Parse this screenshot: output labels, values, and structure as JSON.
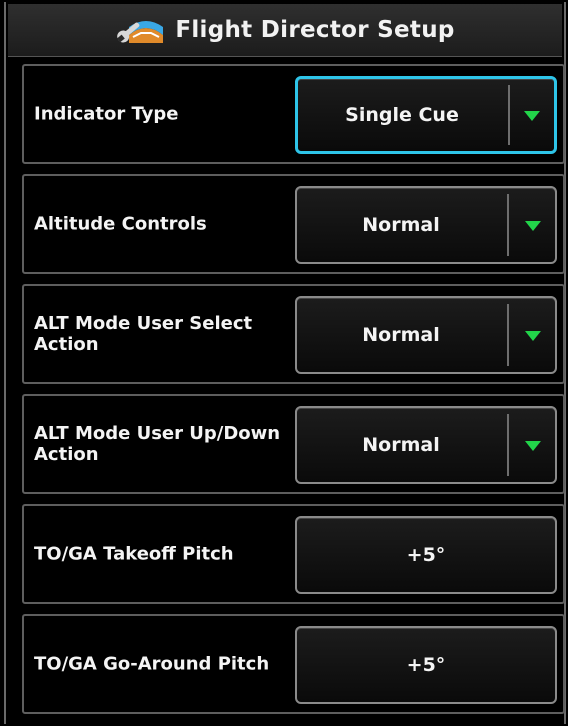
{
  "header": {
    "title": "Flight Director Setup",
    "icon": "wrench-setup-icon"
  },
  "settings": [
    {
      "label": "Indicator Type",
      "value": "Single Cue",
      "control": "dropdown",
      "selected": true
    },
    {
      "label": "Altitude Controls",
      "value": "Normal",
      "control": "dropdown",
      "selected": false
    },
    {
      "label": "ALT Mode User Select Action",
      "value": "Normal",
      "control": "dropdown",
      "selected": false
    },
    {
      "label": "ALT Mode User Up/Down Action",
      "value": "Normal",
      "control": "dropdown",
      "selected": false
    },
    {
      "label": "TO/GA Takeoff Pitch",
      "value": "+5°",
      "control": "button",
      "selected": false
    },
    {
      "label": "TO/GA Go-Around Pitch",
      "value": "+5°",
      "control": "button",
      "selected": false
    }
  ],
  "colors": {
    "selection_border": "#2ec4e8",
    "dropdown_arrow": "#22d44a",
    "background": "#000000"
  }
}
